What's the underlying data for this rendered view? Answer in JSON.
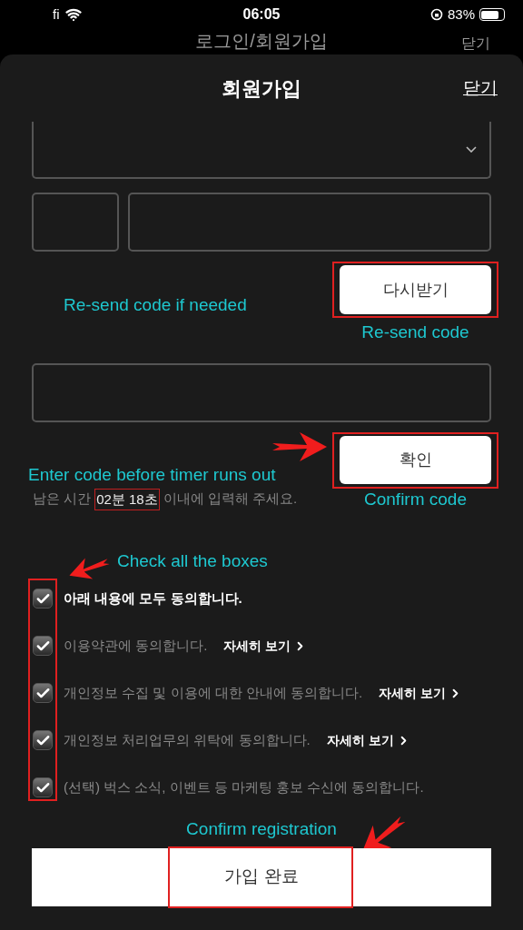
{
  "status_bar": {
    "carrier": "fi",
    "time": "06:05",
    "battery": "83%"
  },
  "background": {
    "title": "로그인/회원가입",
    "close": "닫기"
  },
  "sheet": {
    "title": "회원가입",
    "close": "닫기"
  },
  "resend_button": "다시받기",
  "confirm_button": "확인",
  "timer": {
    "prefix": "남은 시간",
    "value": "02분 18초",
    "suffix": "이내에 입력해 주세요."
  },
  "agreements": [
    {
      "kind": "all",
      "label": "아래 내용에 모두 동의합니다.",
      "checked": true
    },
    {
      "kind": "item",
      "label": "이용약관에 동의합니다.",
      "link": "자세히 보기",
      "checked": true
    },
    {
      "kind": "item",
      "label": "개인정보 수집 및 이용에 대한 안내에 동의합니다.",
      "link": "자세히 보기",
      "checked": true
    },
    {
      "kind": "item",
      "label": "개인정보 처리업무의 위탁에 동의합니다.",
      "link": "자세히 보기",
      "checked": true
    },
    {
      "kind": "item",
      "label": "(선택) 벅스 소식, 이벤트 등 마케팅 홍보 수신에 동의합니다.",
      "checked": true
    }
  ],
  "submit_button": "가입 완료",
  "annotations": {
    "resend_hint": "Re-send code if needed",
    "resend_label": "Re-send code",
    "timer_hint": "Enter code before timer runs out",
    "confirm_label": "Confirm code",
    "checkbox_hint": "Check all the boxes",
    "submit_hint": "Confirm registration"
  }
}
